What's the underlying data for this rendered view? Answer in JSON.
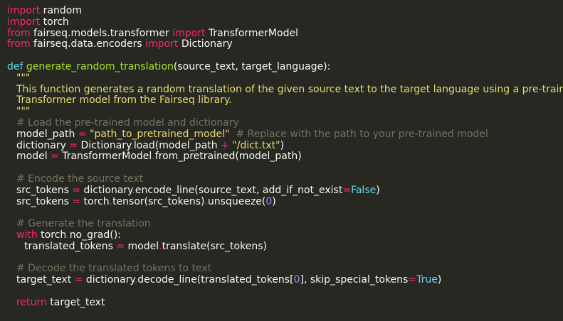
{
  "code": {
    "l1": {
      "kw": "import",
      "rest": " random"
    },
    "l2": {
      "kw": "import",
      "rest": " torch"
    },
    "l3": {
      "kw1": "from",
      "mod": " fairseq.models.transformer ",
      "kw2": "import",
      "rest": " TransformerModel"
    },
    "l4": {
      "kw1": "from",
      "mod": " fairseq.data.encoders ",
      "kw2": "import",
      "rest": " Dictionary"
    },
    "l6": {
      "def": "def",
      "name": " generate_random_translation",
      "params": "(source_text, target_language):"
    },
    "l7": {
      "doc": "\"\"\""
    },
    "l8": {
      "doc": "This function generates a random translation of the given source text to the target language using a pre-trained"
    },
    "l9": {
      "doc": "Transformer model from the Fairseq library."
    },
    "l10": {
      "doc": "\"\"\""
    },
    "l11": {
      "cmt": "# Load the pre-trained model and dictionary"
    },
    "l12": {
      "a": "model_path ",
      "op": "=",
      "b": " ",
      "str": "\"path_to_pretrained_model\"",
      "c": "  ",
      "cmt": "# Replace with the path to your pre-trained model"
    },
    "l13": {
      "a": "dictionary ",
      "op": "=",
      "b": " Dictionary",
      "dot": ".",
      "c": "load(model_path ",
      "plus": "+",
      "d": " ",
      "str": "\"/dict.txt\"",
      "e": ")"
    },
    "l14": {
      "a": "model ",
      "op": "=",
      "b": " TransformerModel",
      "dot": ".",
      "c": "from_pretrained(model_path)"
    },
    "l16": {
      "cmt": "# Encode the source text"
    },
    "l17": {
      "a": "src_tokens ",
      "op": "=",
      "b": " dictionary",
      "dot": ".",
      "c": "encode_line(source_text, add_if_not_exist",
      "eq": "=",
      "kw": "False",
      "d": ")"
    },
    "l18": {
      "a": "src_tokens ",
      "op": "=",
      "b": " torch",
      "dot": ".",
      "c": "tensor(src_tokens)",
      "dot2": ".",
      "d": "unsqueeze(",
      "num": "0",
      "e": ")"
    },
    "l20": {
      "cmt": "# Generate the translation"
    },
    "l21": {
      "kw": "with",
      "a": " torch",
      "dot": ".",
      "b": "no_grad():"
    },
    "l22": {
      "a": "translated_tokens ",
      "op": "=",
      "b": " model",
      "dot": ".",
      "c": "translate(src_tokens)"
    },
    "l24": {
      "cmt": "# Decode the translated tokens to text"
    },
    "l25": {
      "a": "target_text ",
      "op": "=",
      "b": " dictionary",
      "dot": ".",
      "c": "decode_line(translated_tokens[",
      "num": "0",
      "d": "], skip_special_tokens",
      "eq": "=",
      "kw": "True",
      "e": ")"
    },
    "l27": {
      "kw": "return",
      "a": " target_text"
    }
  },
  "colors": {
    "background": "#272822",
    "keyword": "#f92672",
    "definition": "#66d9ef",
    "function_name": "#a6e22e",
    "string": "#e6db74",
    "comment": "#75715e",
    "number": "#ae81ff",
    "text": "#f8f8f2"
  }
}
